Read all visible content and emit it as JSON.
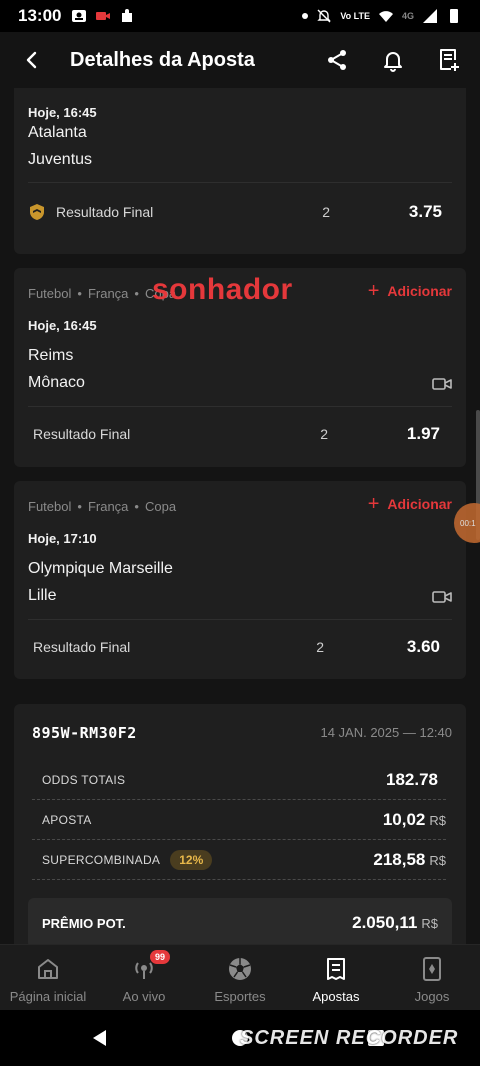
{
  "status_bar": {
    "time": "13:00",
    "volte": "Vo LTE",
    "network": "4G"
  },
  "header": {
    "title": "Detalhes da Aposta"
  },
  "card0": {
    "time": "Hoje, 16:45",
    "home": "Atalanta",
    "away": "Juventus",
    "market": "Resultado Final",
    "selection": "2",
    "odd": "3.75"
  },
  "card1": {
    "sport": "Futebol",
    "country": "França",
    "competition": "Copa",
    "add_label": "Adicionar",
    "time": "Hoje, 16:45",
    "home": "Reims",
    "away": "Mônaco",
    "market": "Resultado Final",
    "selection": "2",
    "odd": "1.97"
  },
  "card2": {
    "sport": "Futebol",
    "country": "França",
    "competition": "Copa",
    "add_label": "Adicionar",
    "time": "Hoje, 17:10",
    "home": "Olympique Marseille",
    "away": "Lille",
    "market": "Resultado Final",
    "selection": "2",
    "odd": "3.60"
  },
  "watermark": "sonhador",
  "summary": {
    "code": "895W-RM30F2",
    "date": "14 JAN. 2025 — 12:40",
    "odds_label": "ODDS TOTAIS",
    "odds_value": "182.78",
    "stake_label": "APOSTA",
    "stake_value": "10,02",
    "currency": "R$",
    "super_label": "SUPERCOMBINADA",
    "super_badge": "12%",
    "super_value": "218,58",
    "prize_label": "PRÊMIO POT.",
    "prize_value": "2.050,11"
  },
  "rec_bubble": "00:1",
  "nav": {
    "home": "Página inicial",
    "live": "Ao vivo",
    "live_badge": "99",
    "sports": "Esportes",
    "bets": "Apostas",
    "games": "Jogos"
  },
  "recorder_text": "SCREEN RECORDER",
  "colors": {
    "accent": "#e5383b",
    "background": "#141414",
    "card": "#1f1f1f",
    "badge_bg": "#4a3d1f",
    "badge_text": "#e8b84a"
  }
}
